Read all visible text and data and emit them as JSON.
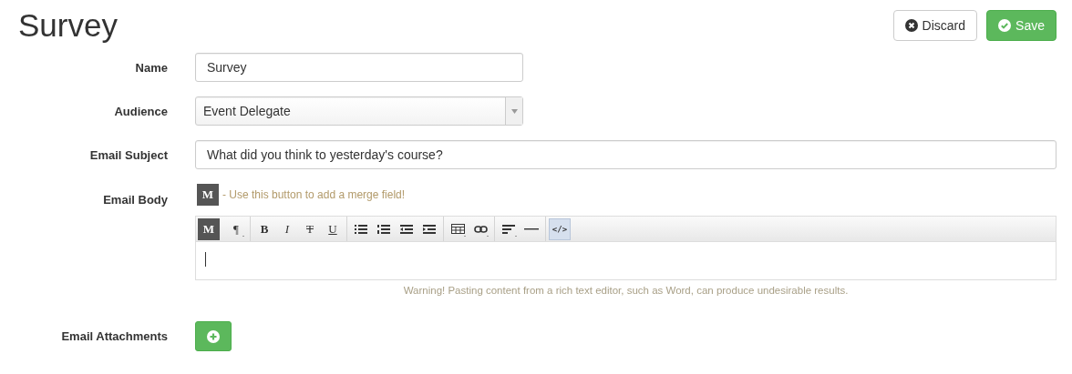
{
  "title": "Survey",
  "actions": [
    {
      "kind": "discard",
      "label": "Discard"
    },
    {
      "kind": "save",
      "label": "Save"
    }
  ],
  "fields": [
    {
      "kind": "text",
      "label": "Name",
      "value": "Survey",
      "wide": false
    },
    {
      "kind": "select",
      "label": "Audience",
      "value": "Event Delegate",
      "wide": false
    },
    {
      "kind": "text",
      "label": "Email Subject",
      "value": "What did you think to yesterday's course?",
      "wide": true
    }
  ],
  "email_body": {
    "label": "Email Body",
    "merge_button": "M",
    "merge_hint": "- Use this button to add a merge field!",
    "toolbar": [
      [
        {
          "kind": "merge",
          "text": "M",
          "selected": false
        }
      ],
      [
        {
          "kind": "paragraph",
          "text": "¶",
          "selected": false
        }
      ],
      [
        {
          "kind": "bold",
          "text": "B",
          "selected": false
        },
        {
          "kind": "italic",
          "text": "I",
          "selected": false
        },
        {
          "kind": "strike",
          "text": "T",
          "selected": false
        },
        {
          "kind": "underline",
          "text": "U",
          "selected": false
        }
      ],
      [
        {
          "kind": "bullet-list",
          "selected": false
        },
        {
          "kind": "number-list",
          "selected": false
        },
        {
          "kind": "outdent",
          "selected": false
        },
        {
          "kind": "indent",
          "selected": false
        }
      ],
      [
        {
          "kind": "table",
          "selected": false
        },
        {
          "kind": "link",
          "selected": false
        }
      ],
      [
        {
          "kind": "align",
          "selected": false
        },
        {
          "kind": "rule",
          "selected": false
        }
      ],
      [
        {
          "kind": "code",
          "text": "</>",
          "selected": true
        }
      ]
    ],
    "warning": "Warning! Pasting content from a rich text editor, such as Word, can produce undesirable results."
  },
  "attachments": {
    "label": "Email Attachments"
  }
}
